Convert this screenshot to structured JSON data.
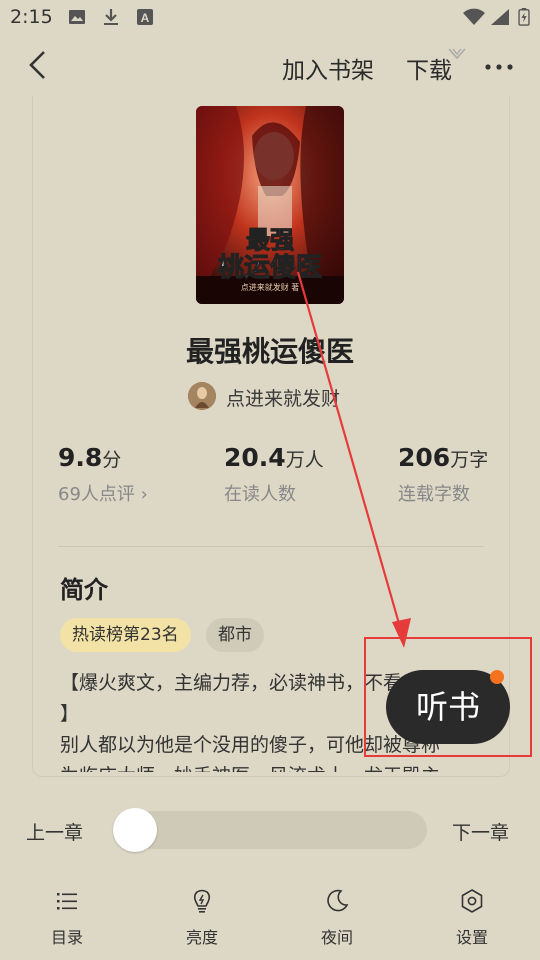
{
  "status_bar": {
    "time": "2:15"
  },
  "header": {
    "add_shelf": "加入书架",
    "download": "下载"
  },
  "book": {
    "title": "最强桃运傻医",
    "author": "点进来就发财",
    "cover_title_line1": "最强",
    "cover_title_line2": "桃运傻医",
    "cover_author": "点进来就发财 著"
  },
  "stats": [
    {
      "value": "9.8",
      "unit": "分",
      "label": "69人点评 ›"
    },
    {
      "value": "20.4",
      "unit": "万人",
      "label": "在读人数"
    },
    {
      "value": "206",
      "unit": "万字",
      "label": "连载字数"
    }
  ],
  "intro": {
    "heading": "简介",
    "tags": [
      "热读榜第23名",
      "都市"
    ],
    "text_line1": "【爆火爽文，主编力荐，必读神书，不看后悔",
    "text_line2": "】",
    "text_line3": "别人都以为他是个没用的傻子，可他却被尊称",
    "text_line4": "为临床大师，妙手神医，风流术士，龙王殿主"
  },
  "listen_button": "听书",
  "reader_nav": {
    "prev": "上一章",
    "next": "下一章",
    "progress": 0
  },
  "tabs": [
    {
      "label": "目录",
      "icon": "list-icon"
    },
    {
      "label": "亮度",
      "icon": "brightness-icon"
    },
    {
      "label": "夜间",
      "icon": "moon-icon"
    },
    {
      "label": "设置",
      "icon": "settings-icon"
    }
  ],
  "colors": {
    "background": "#ddd8c6",
    "annotation": "#e53b3b",
    "badge_dot": "#f5731e",
    "tag_highlight": "#f3e2a6"
  }
}
